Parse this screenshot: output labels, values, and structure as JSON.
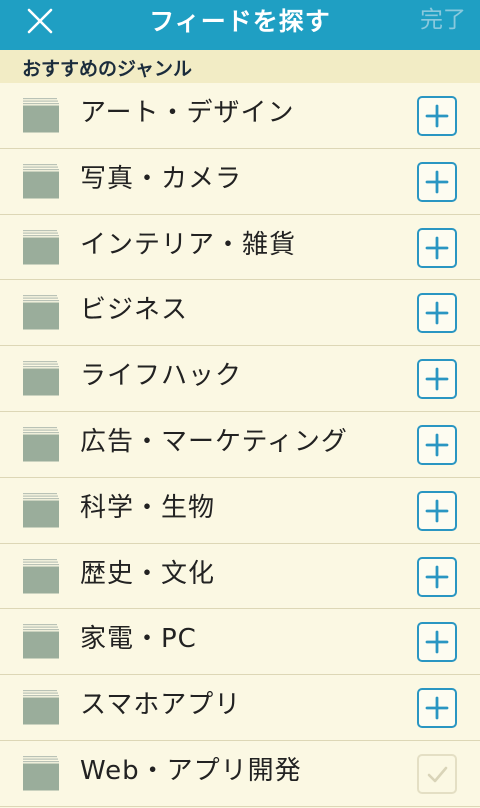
{
  "header": {
    "title": "フィードを探す",
    "done_label": "完了"
  },
  "section": {
    "title": "おすすめのジャンル"
  },
  "genres": [
    {
      "label": "アート・デザイン",
      "status": "add"
    },
    {
      "label": "写真・カメラ",
      "status": "add"
    },
    {
      "label": "インテリア・雑貨",
      "status": "add"
    },
    {
      "label": "ビジネス",
      "status": "add"
    },
    {
      "label": "ライフハック",
      "status": "add"
    },
    {
      "label": "広告・マーケティング",
      "status": "add"
    },
    {
      "label": "科学・生物",
      "status": "add"
    },
    {
      "label": "歴史・文化",
      "status": "add"
    },
    {
      "label": "家電・PC",
      "status": "add"
    },
    {
      "label": "スマホアプリ",
      "status": "add"
    },
    {
      "label": "Web・アプリ開発",
      "status": "added"
    }
  ],
  "icons": {
    "close": "close-icon",
    "folder": "folder-icon",
    "add": "plus-icon",
    "added": "check-icon"
  },
  "colors": {
    "header_bg": "#1f9fc3",
    "page_bg": "#fbf8e3",
    "section_bg": "#f2ecc5",
    "accent": "#2a96c2",
    "folder": "#9aad9b"
  }
}
